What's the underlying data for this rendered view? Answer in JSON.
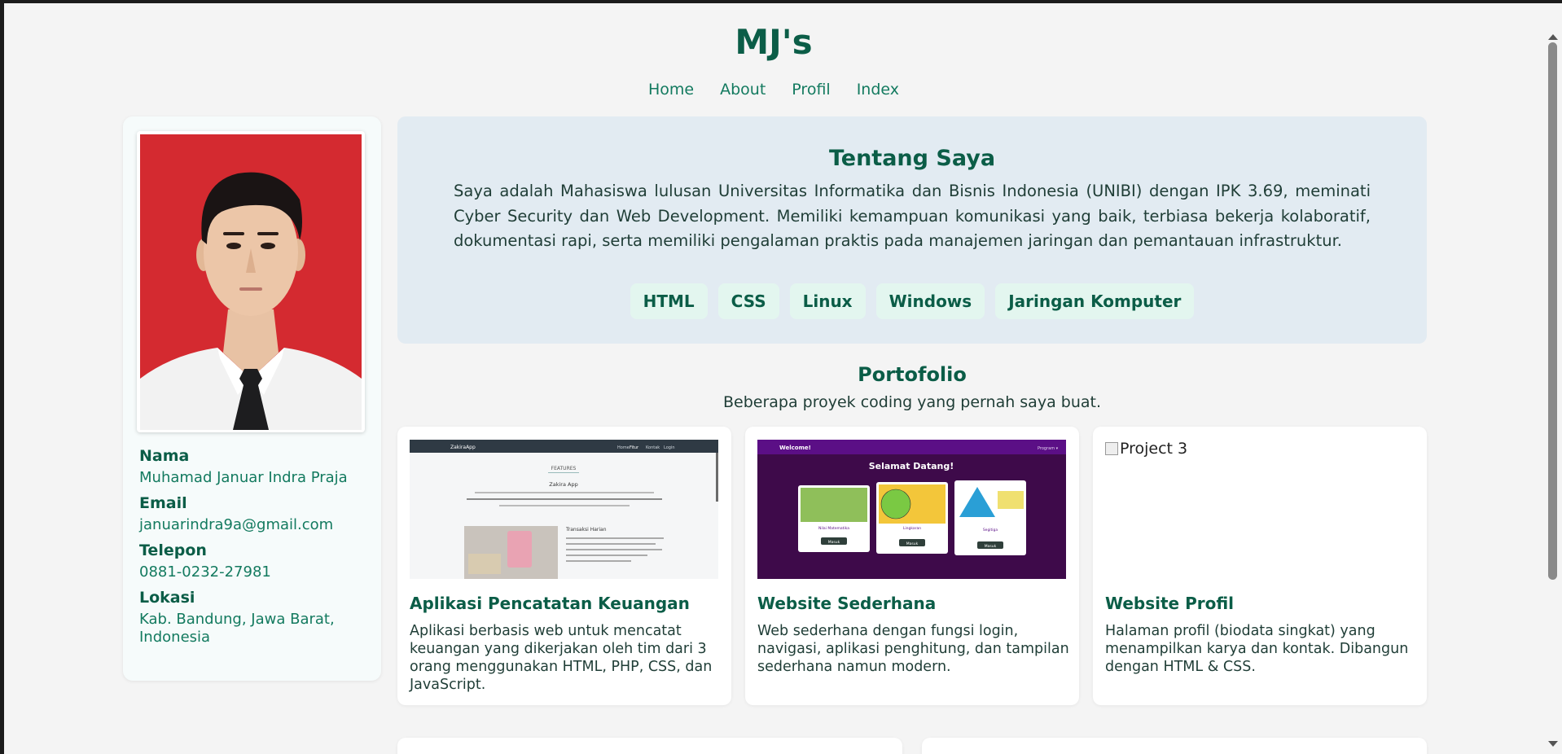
{
  "site": {
    "title": "MJ's"
  },
  "nav": {
    "items": [
      "Home",
      "About",
      "Profil",
      "Index"
    ]
  },
  "profile": {
    "name_label": "Nama",
    "name": "Muhamad Januar Indra Praja",
    "email_label": "Email",
    "email": "januarindra9a@gmail.com",
    "phone_label": "Telepon",
    "phone": "0881-0232-27981",
    "location_label": "Lokasi",
    "location": "Kab. Bandung, Jawa Barat, Indonesia"
  },
  "about": {
    "title": "Tentang Saya",
    "text": "Saya adalah Mahasiswa lulusan Universitas Informatika dan Bisnis Indonesia (UNIBI) dengan IPK 3.69, meminati Cyber Security dan Web Development. Memiliki kemampuan komunikasi yang baik, terbiasa bekerja kolaboratif, dokumentasi rapi, serta memiliki pengalaman praktis pada manajemen jaringan dan pemantauan infrastruktur.",
    "skills": [
      "HTML",
      "CSS",
      "Linux",
      "Windows",
      "Jaringan Komputer"
    ]
  },
  "portfolio": {
    "title": "Portofolio",
    "subtitle": "Beberapa proyek coding yang pernah saya buat.",
    "projects": [
      {
        "title": "Aplikasi Pencatatan Keuangan",
        "desc": "Aplikasi berbasis web untuk mencatat keuangan yang dikerjakan oleh tim dari 3 orang menggunakan HTML, PHP, CSS, dan JavaScript.",
        "thumb": {
          "brand": "ZakiraApp",
          "nav": [
            "Home",
            "Fitur",
            "Kontak",
            "Login"
          ],
          "section": "FEATURES",
          "heading": "Zakira App",
          "feature": "Transaksi Harian"
        }
      },
      {
        "title": "Website Sederhana",
        "desc": "Web sederhana dengan fungsi login, navigasi, aplikasi penghitung, dan tampilan sederhana namun modern.",
        "thumb": {
          "welcome": "Welcome!",
          "program": "Program ▾",
          "heading": "Selamat Datang!",
          "tiles": [
            "Nilai Matematika",
            "Lingkaran",
            "Segitiga"
          ],
          "button": "Masuk"
        }
      },
      {
        "title": "Website Profil",
        "desc": "Halaman profil (biodata singkat) yang menampilkan karya dan kontak. Dibangun dengan HTML & CSS.",
        "thumb_alt": "Project 3"
      }
    ]
  },
  "colors": {
    "primary": "#0b5d47",
    "accent": "#137a5f",
    "about_bg": "#e2ebf2",
    "skill_bg": "#e3f6ef"
  }
}
